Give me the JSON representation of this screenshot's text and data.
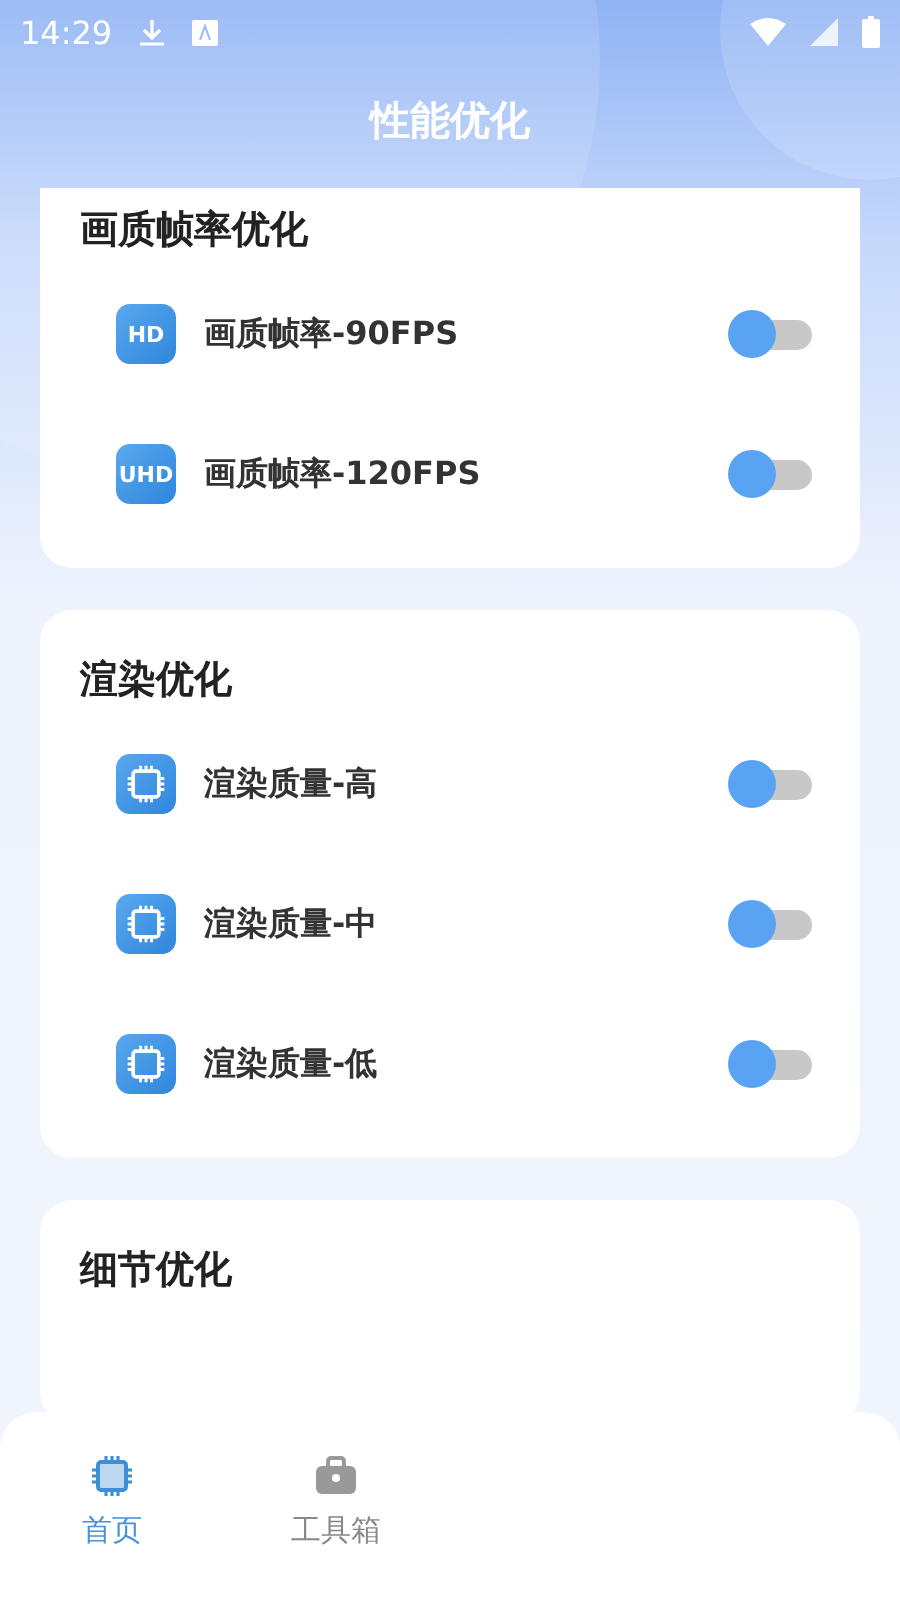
{
  "status_bar": {
    "time": "14:29"
  },
  "header": {
    "title": "性能优化"
  },
  "sections": [
    {
      "title": "画质帧率优化",
      "items": [
        {
          "icon": "HD",
          "kind": "badge",
          "label": "画质帧率-90FPS",
          "on": false
        },
        {
          "icon": "UHD",
          "kind": "badge",
          "label": "画质帧率-120FPS",
          "on": false
        }
      ]
    },
    {
      "title": "渲染优化",
      "items": [
        {
          "kind": "chip",
          "label": "渲染质量-高",
          "on": false
        },
        {
          "kind": "chip",
          "label": "渲染质量-中",
          "on": false
        },
        {
          "kind": "chip",
          "label": "渲染质量-低",
          "on": false
        }
      ]
    },
    {
      "title": "细节优化"
    }
  ],
  "bottom_nav": [
    {
      "kind": "chip",
      "label": "首页",
      "selected": true
    },
    {
      "kind": "toolbox",
      "label": "工具箱",
      "selected": false
    }
  ]
}
